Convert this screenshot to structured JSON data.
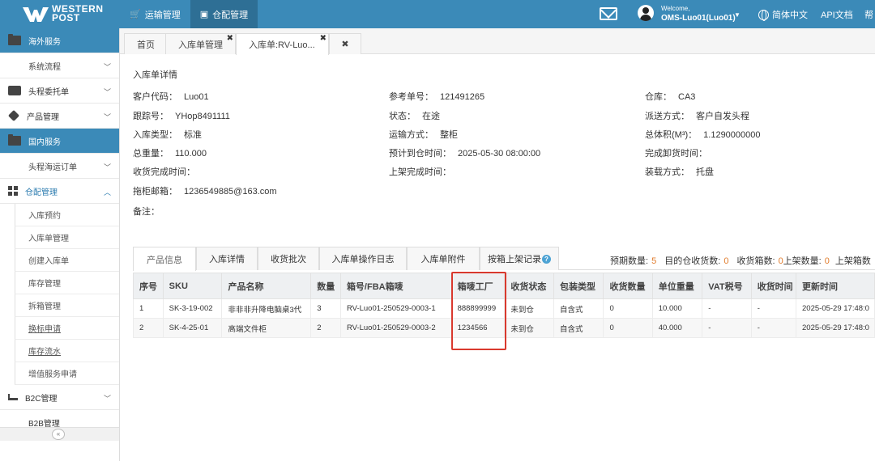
{
  "header": {
    "brand_line1": "WESTERN",
    "brand_line2": "POST",
    "nav": [
      {
        "label": "运输管理",
        "icon": "truck-icon"
      },
      {
        "label": "仓配管理",
        "icon": "warehouse-icon"
      }
    ],
    "welcome": "Welcome,",
    "username": "OMS-Luo01(Luo01)",
    "language": "简体中文",
    "api_docs": "API文档",
    "help": "帮"
  },
  "sidebar": {
    "items": [
      {
        "label": "海外服务",
        "icon": "folder-icon"
      },
      {
        "label": "系统流程"
      },
      {
        "label": "头程委托单",
        "icon": "briefcase-icon"
      },
      {
        "label": "产品管理",
        "icon": "tag-icon"
      },
      {
        "label": "国内服务",
        "icon": "folder-icon"
      },
      {
        "label": "头程海运订单"
      },
      {
        "label": "仓配管理",
        "icon": "grid-icon"
      },
      {
        "label": "B2C管理",
        "icon": "cart-icon"
      },
      {
        "label": "B2B管理"
      }
    ],
    "warehouse_children": [
      "入库预约",
      "入库单管理",
      "创建入库单",
      "库存管理",
      "拆箱管理",
      "换标申请",
      "库存流水",
      "增值服务申请"
    ]
  },
  "tabs": [
    "首页",
    "入库单管理",
    "入库单:RV-Luo..."
  ],
  "detail": {
    "title": "入库单详情",
    "fields": {
      "customer_code": {
        "label": "客户代码：",
        "value": "Luo01"
      },
      "ref_no": {
        "label": "参考单号：",
        "value": "121491265"
      },
      "warehouse": {
        "label": "仓库：",
        "value": "CA3"
      },
      "tracking_no": {
        "label": "跟踪号：",
        "value": "YHop8491111"
      },
      "status": {
        "label": "状态：",
        "value": "在途"
      },
      "delivery_method": {
        "label": "派送方式：",
        "value": "客户自发头程"
      },
      "inbound_type": {
        "label": "入库类型：",
        "value": "标准"
      },
      "transport_method": {
        "label": "运输方式：",
        "value": "整柜"
      },
      "total_volume": {
        "label": "总体积(M³)：",
        "value": "1.1290000000"
      },
      "total_weight": {
        "label": "总重量：",
        "value": "110.000"
      },
      "eta": {
        "label": "预计到仓时间：",
        "value": "2025-05-30 08:00:00"
      },
      "unload_done": {
        "label": "完成卸货时间：",
        "value": ""
      },
      "receive_done": {
        "label": "收货完成时间：",
        "value": ""
      },
      "shelf_done": {
        "label": "上架完成时间：",
        "value": ""
      },
      "loading_method": {
        "label": "装载方式：",
        "value": "托盘"
      },
      "container_email": {
        "label": "拖柜邮箱：",
        "value": "1236549885@163.com"
      },
      "remarks": {
        "label": "备注：",
        "value": ""
      }
    }
  },
  "subtabs": [
    "产品信息",
    "入库详情",
    "收货批次",
    "入库单操作日志",
    "入库单附件",
    "按箱上架记录"
  ],
  "stats": {
    "expected_label": "预期数量:",
    "expected": "5",
    "received_label": "目的仓收货数:",
    "received": "0",
    "boxes_label": "收货箱数:",
    "boxes": "0",
    "shelved_label": "上架数量:",
    "shelved": "0",
    "shelved_boxes_label": "上架箱数"
  },
  "table": {
    "columns": [
      "序号",
      "SKU",
      "产品名称",
      "数量",
      "箱号/FBA箱唛",
      "箱唛工厂",
      "收货状态",
      "包装类型",
      "收货数量",
      "单位重量",
      "VAT税号",
      "收货时间",
      "更新时间"
    ],
    "rows": [
      [
        "1",
        "SK-3-19-002",
        "非非非升降电脑桌3代",
        "3",
        "RV-Luo01-250529-0003-1",
        "888899999",
        "未到仓",
        "自含式",
        "0",
        "10.000",
        "-",
        "-",
        "2025-05-29 17:48:0"
      ],
      [
        "2",
        "SK-4-25-01",
        "高端文件柜",
        "2",
        "RV-Luo01-250529-0003-2",
        "1234566",
        "未到仓",
        "自含式",
        "0",
        "40.000",
        "-",
        "-",
        "2025-05-29 17:48:0"
      ]
    ]
  },
  "colors": {
    "topbar": "#3b8ab8",
    "accent_orange": "#e07c2c",
    "highlight_red": "#d9392e"
  }
}
